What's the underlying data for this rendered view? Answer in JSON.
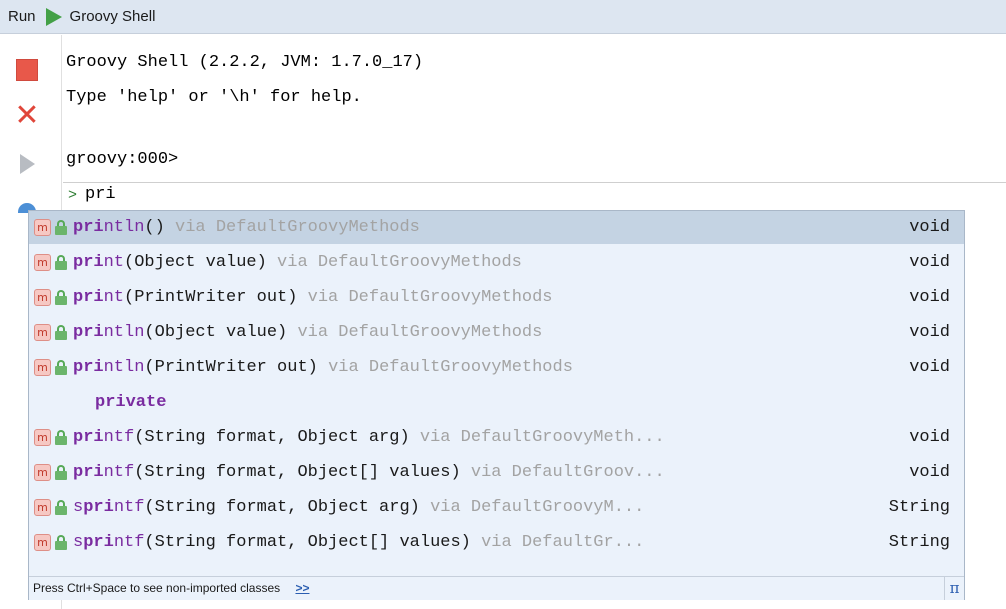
{
  "header": {
    "run_label": "Run",
    "tool_title": "Groovy Shell"
  },
  "console": {
    "lines": [
      "Groovy Shell (2.2.2, JVM: 1.7.0_17)",
      "Type 'help' or '\\h' for help.",
      "",
      "groovy:000>"
    ],
    "input_prompt": ">",
    "input_text": "pri"
  },
  "completion": {
    "items": [
      {
        "match": "pri",
        "rest": "ntln",
        "params": "()",
        "via": "via DefaultGroovyMethods",
        "type": "void"
      },
      {
        "match": "pri",
        "rest": "nt",
        "params": "(Object value)",
        "via": "via DefaultGroovyMethods",
        "type": "void"
      },
      {
        "match": "pri",
        "rest": "nt",
        "params": "(PrintWriter out)",
        "via": "via DefaultGroovyMethods",
        "type": "void"
      },
      {
        "match": "pri",
        "rest": "ntln",
        "params": "(Object value)",
        "via": "via DefaultGroovyMethods",
        "type": "void"
      },
      {
        "match": "pri",
        "rest": "ntln",
        "params": "(PrintWriter out)",
        "via": "via DefaultGroovyMethods",
        "type": "void"
      },
      {
        "keyword": "private"
      },
      {
        "match": "pri",
        "rest": "ntf",
        "params": "(String format, Object arg)",
        "via": "via DefaultGroovyMeth...",
        "type": "void"
      },
      {
        "match": "pri",
        "rest": "ntf",
        "params": "(String format, Object[] values)",
        "via": "via DefaultGroov...",
        "type": "void"
      },
      {
        "prefix": "s",
        "match": "pri",
        "rest": "ntf",
        "params": "(String format, Object arg)",
        "via": "via DefaultGroovyM...",
        "type": "String"
      },
      {
        "prefix": "s",
        "match": "pri",
        "rest": "ntf",
        "params": "(String format, Object[] values)",
        "via": "via DefaultGr...",
        "type": "String"
      }
    ],
    "footer_text": "Press Ctrl+Space to see non-imported classes",
    "footer_link": ">>",
    "pi_symbol": "π",
    "method_icon_letter": "m"
  },
  "colors": {
    "selected_row": "#c4d3e3",
    "popup_bg": "#ebf2fb",
    "method_name": "#7a2ca0",
    "via_text": "#a3a3a3"
  }
}
